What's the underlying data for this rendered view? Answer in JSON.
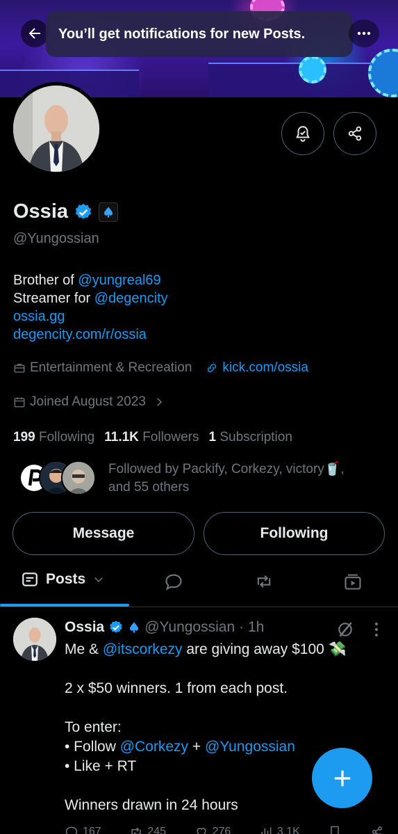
{
  "toast": {
    "text": "You’ll get notifications for new Posts."
  },
  "top_bar": {
    "back_icon": "arrow-left-icon",
    "more_icon": "more-horizontal-icon"
  },
  "profile": {
    "name": "Ossia",
    "handle": "@Yungossian",
    "bio": {
      "line1_prefix": "Brother of ",
      "line1_mention": "@yungreal69",
      "line2_prefix": "Streamer for ",
      "line2_mention": "@degencity",
      "line3_link": "ossia.gg",
      "line4_link": "degencity.com/r/ossia"
    },
    "category": "Entertainment & Recreation",
    "website": "kick.com/ossia",
    "joined": "Joined August 2023",
    "counts": {
      "following_num": "199",
      "following_label": "Following",
      "followers_num": "11.1K",
      "followers_label": "Followers",
      "subs_num": "1",
      "subs_label": "Subscription"
    },
    "followed_by_line1": "Followed by Packify, Corkezy, victory🥤,",
    "followed_by_line2": "and 55 others"
  },
  "buttons": {
    "message": "Message",
    "following": "Following"
  },
  "tabs": {
    "posts": "Posts"
  },
  "post": {
    "author": "Ossia",
    "handle": "@Yungossian",
    "time": "· 1h",
    "line1_prefix": "Me & ",
    "line1_mention": "@itscorkezy",
    "line1_suffix": " are giving away $100 💸",
    "line2": "2 x $50 winners. 1 from each post.",
    "line3": "To enter:",
    "line4_prefix": "• Follow ",
    "line4_mention1": "@Corkezy",
    "line4_mid": " + ",
    "line4_mention2": "@Yungossian",
    "line5": "• Like + RT",
    "line6": "Winners drawn in 24 hours",
    "replies": "167",
    "reposts": "245",
    "likes": "276",
    "views": "3.1K"
  },
  "colors": {
    "accent": "#1d9bf0",
    "background": "#000000",
    "muted": "#71767b",
    "border": "#536471"
  }
}
